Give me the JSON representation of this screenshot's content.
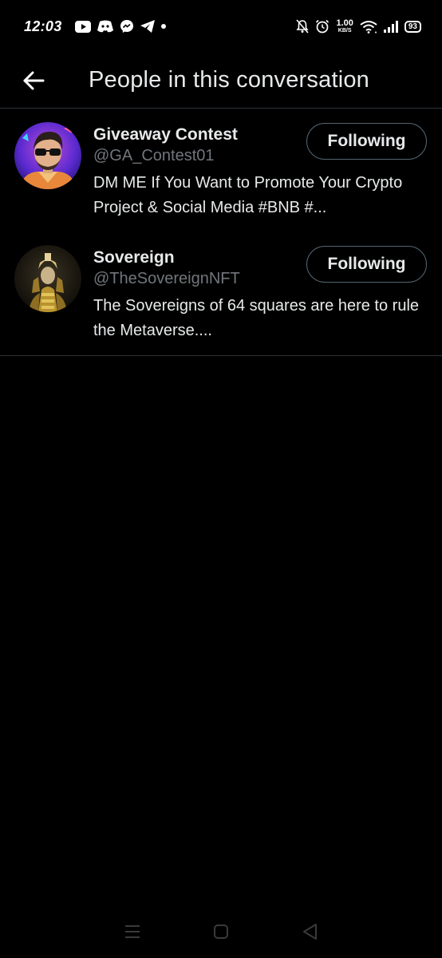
{
  "status_bar": {
    "time": "12:03",
    "net_speed_value": "1.00",
    "net_speed_unit": "KB/S",
    "battery": "93",
    "left_icons": [
      "youtube-icon",
      "discord-icon",
      "messenger-icon",
      "telegram-icon",
      "dot-icon"
    ],
    "right_icons": [
      "bell-off-icon",
      "alarm-icon",
      "wifi-icon",
      "signal-icon",
      "battery-icon"
    ]
  },
  "header": {
    "back_icon": "arrow-left-icon",
    "title": "People in this conversation"
  },
  "people": [
    {
      "name": "Giveaway Contest",
      "handle": "@GA_Contest01",
      "bio": "DM ME If You Want to Promote Your Crypto Project & Social Media #BNB #...",
      "button_label": "Following"
    },
    {
      "name": "Sovereign",
      "handle": "@TheSovereignNFT",
      "bio": "The Sovereigns of 64 squares are here to rule the Metaverse....",
      "button_label": "Following"
    }
  ],
  "nav_bar": {
    "icons": [
      "menu-icon",
      "home-square-icon",
      "back-triangle-icon"
    ]
  },
  "colors": {
    "background": "#000000",
    "text_primary": "#e7e9ea",
    "text_secondary": "#71767b",
    "divider": "#2f3336",
    "button_border": "#536471"
  }
}
